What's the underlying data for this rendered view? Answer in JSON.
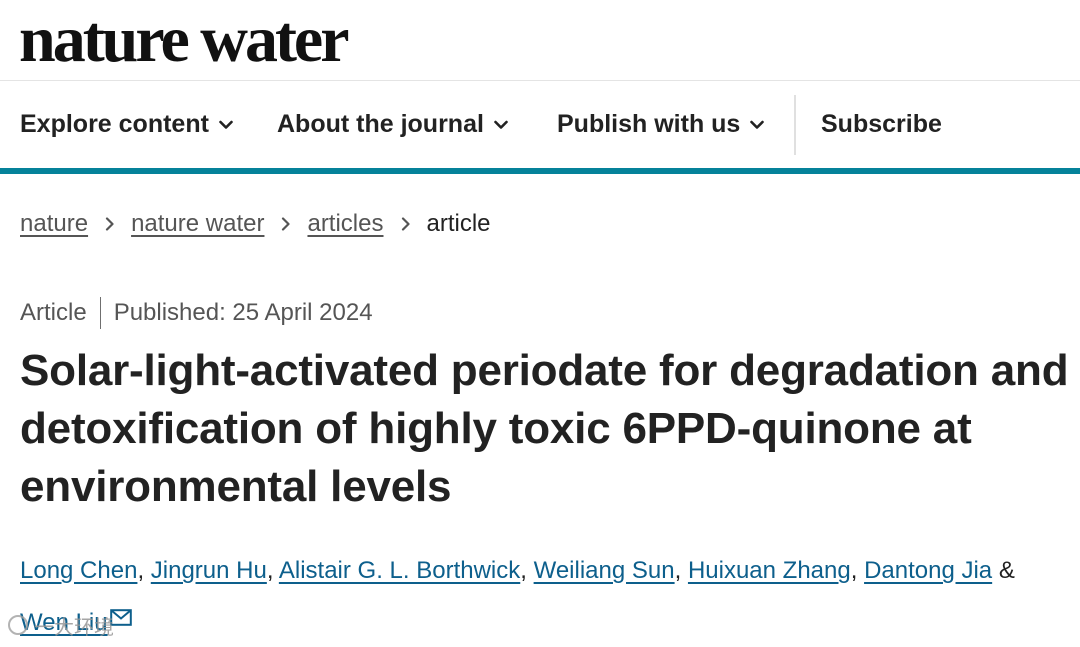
{
  "header": {
    "logo": "nature water"
  },
  "nav": {
    "items": [
      {
        "label": "Explore content",
        "has_dropdown": true
      },
      {
        "label": "About the journal",
        "has_dropdown": true
      },
      {
        "label": "Publish with us",
        "has_dropdown": true
      },
      {
        "label": "Subscribe",
        "has_dropdown": false
      }
    ]
  },
  "breadcrumb": {
    "items": [
      "nature",
      "nature water",
      "articles"
    ],
    "current": "article"
  },
  "article": {
    "type": "Article",
    "published": "Published: 25 April 2024",
    "title": "Solar-light-activated periodate for degradation and detoxification of highly toxic 6PPD-quinone at environmental levels",
    "authors": [
      "Long Chen",
      "Jingrun Hu",
      "Alistair G. L. Borthwick",
      "Weiliang Sun",
      "Huixuan Zhang",
      "Dantong Jia",
      "Wen Liu"
    ],
    "author_separator": ",",
    "last_author_joiner": "&",
    "corresponding_icon": "mail-icon"
  },
  "watermark": {
    "text": "一大环境"
  },
  "colors": {
    "accent_bar": "#05829a",
    "author_link": "#0d5f8c",
    "text": "#222222",
    "muted": "#555555"
  }
}
